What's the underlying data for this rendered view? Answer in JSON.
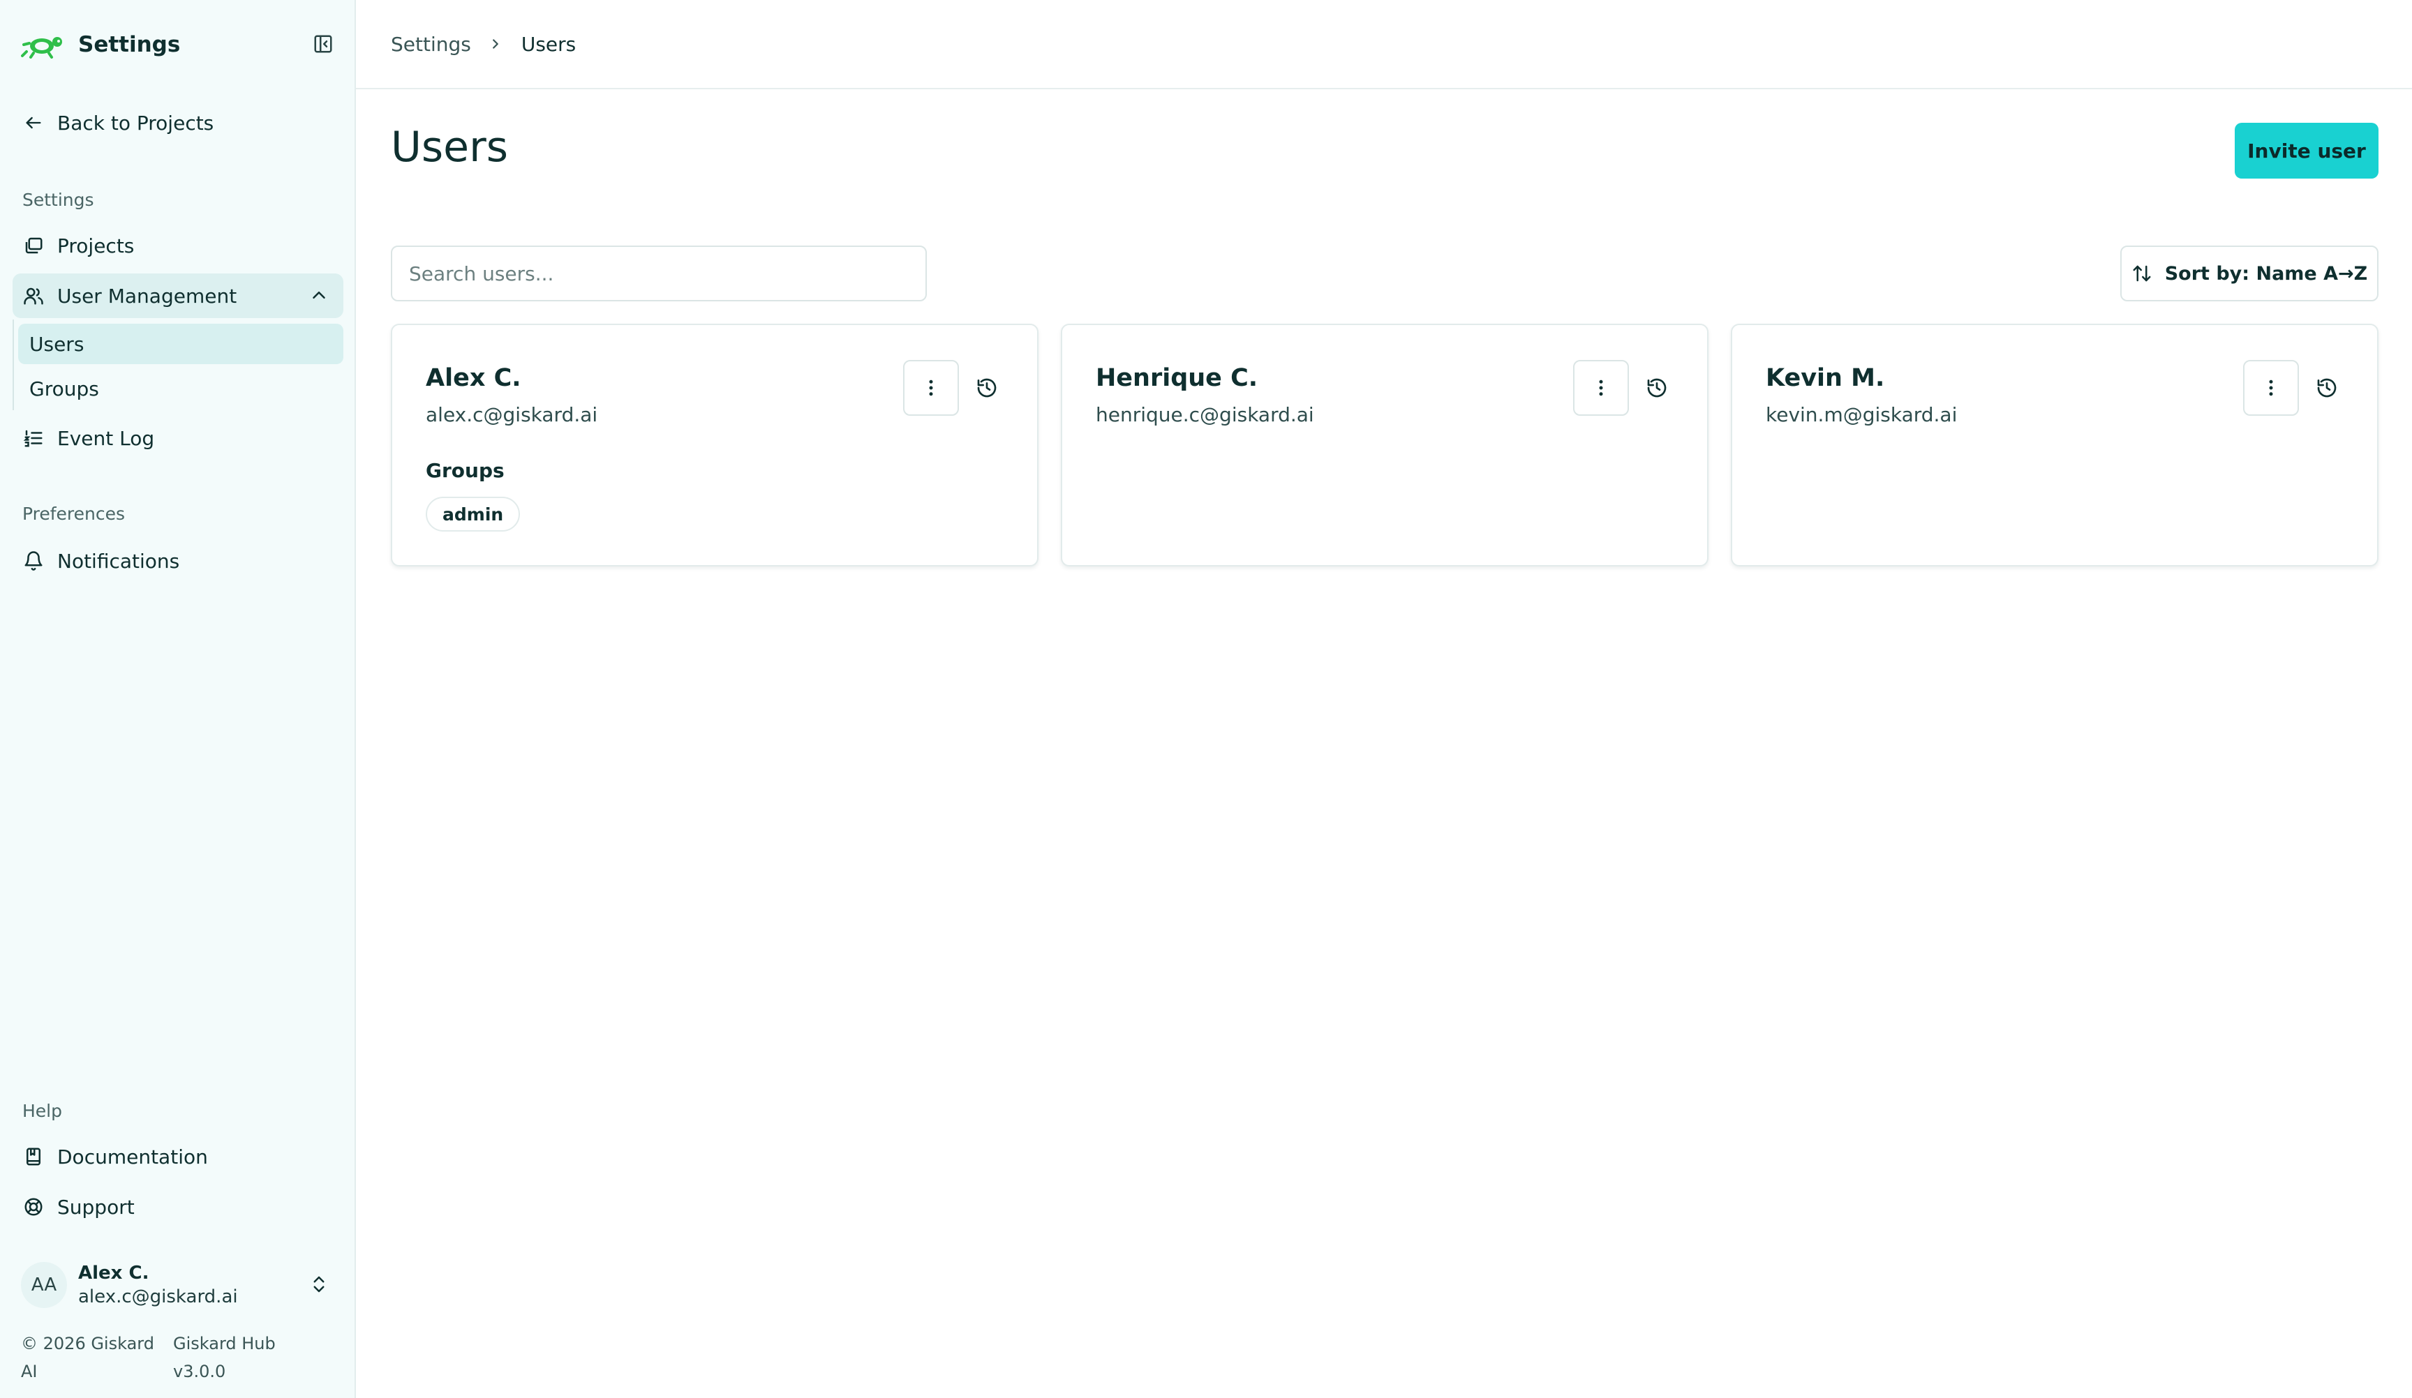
{
  "app": {
    "title": "Settings"
  },
  "sidebar": {
    "back_label": "Back to Projects",
    "sections": {
      "settings": "Settings",
      "preferences": "Preferences",
      "help": "Help"
    },
    "items": {
      "projects": "Projects",
      "user_management": "User Management",
      "users": "Users",
      "groups": "Groups",
      "event_log": "Event Log",
      "notifications": "Notifications",
      "documentation": "Documentation",
      "support": "Support"
    },
    "current_user": {
      "initials": "AA",
      "name": "Alex C.",
      "email": "alex.c@giskard.ai"
    },
    "footer": {
      "copyright": "© 2026 Giskard AI",
      "version": "Giskard Hub v3.0.0"
    }
  },
  "breadcrumb": {
    "parent": "Settings",
    "current": "Users"
  },
  "page": {
    "title": "Users",
    "invite_button": "Invite user",
    "search_placeholder": "Search users...",
    "sort_label": "Sort by: Name A→Z"
  },
  "users": [
    {
      "name": "Alex C.",
      "email": "alex.c@giskard.ai",
      "groups_label": "Groups",
      "groups": [
        "admin"
      ]
    },
    {
      "name": "Henrique C.",
      "email": "henrique.c@giskard.ai"
    },
    {
      "name": "Kevin M.",
      "email": "kevin.m@giskard.ai"
    }
  ],
  "colors": {
    "accent": "#19d1d1",
    "sidebar_bg": "#f3fbfb",
    "active_nav": "#dcf0f0",
    "logo_green": "#2fbf4a",
    "text": "#0f2f2f"
  },
  "icons": {
    "logo": "giskard-turtle-logo",
    "collapse": "sidebar-collapse-icon",
    "back": "arrow-left-icon",
    "projects": "folders-icon",
    "user_management": "users-icon",
    "event_log": "list-ordered-icon",
    "notifications": "bell-icon",
    "documentation": "book-icon",
    "support": "lifebuoy-icon",
    "sort": "arrows-up-down-icon",
    "card_menu": "dots-vertical-icon",
    "history": "history-icon"
  }
}
